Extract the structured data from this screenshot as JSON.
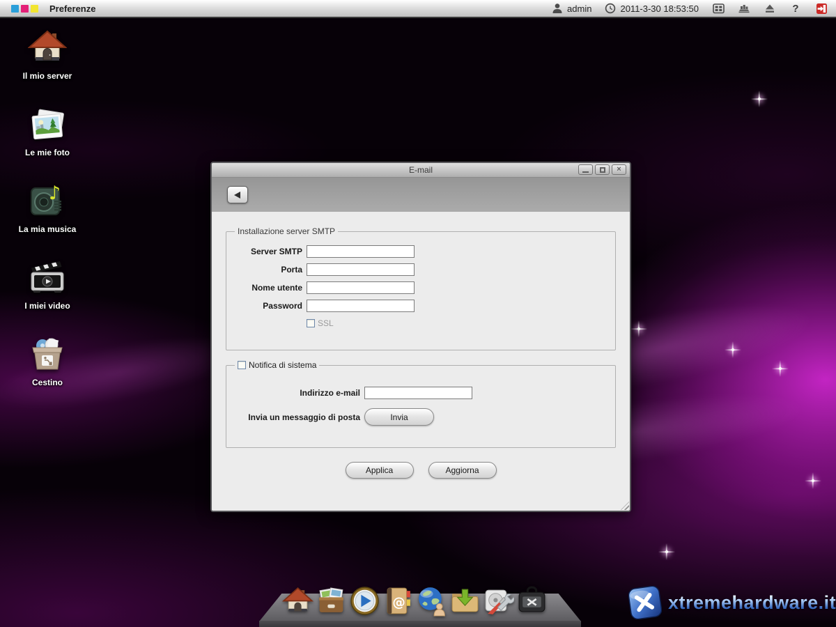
{
  "topbar": {
    "app_title": "Preferenze",
    "logo_colors": [
      "#2b9fd9",
      "#e42178",
      "#f2e531"
    ],
    "user_name": "admin",
    "datetime": "2011-3-30 18:53:50",
    "icons": [
      "user-icon",
      "clock-icon",
      "window-grid-icon",
      "widgets-icon",
      "eject-icon",
      "help-icon",
      "logout-icon"
    ],
    "help_glyph": "?"
  },
  "desktop": {
    "items": [
      {
        "label": "Il mio server",
        "icon": "home-icon"
      },
      {
        "label": "Le mie foto",
        "icon": "photos-icon"
      },
      {
        "label": "La mia musica",
        "icon": "music-icon"
      },
      {
        "label": "I miei video",
        "icon": "videos-icon"
      },
      {
        "label": "Cestino",
        "icon": "trash-icon"
      }
    ]
  },
  "dialog": {
    "title": "E-mail",
    "smtp": {
      "legend": "Installazione server SMTP",
      "fields": [
        {
          "label": "Server SMTP",
          "value": ""
        },
        {
          "label": "Porta",
          "value": ""
        },
        {
          "label": "Nome utente",
          "value": ""
        },
        {
          "label": "Password",
          "value": ""
        }
      ],
      "ssl": {
        "label": "SSL",
        "checked": false
      }
    },
    "notify": {
      "legend": "Notifica di sistema",
      "checked": false,
      "email_label": "Indirizzo e-mail",
      "email_value": "",
      "send_label": "Invia un messaggio di posta",
      "send_button": "Invia"
    },
    "buttons": {
      "apply": "Applica",
      "refresh": "Aggiorna"
    }
  },
  "dock": {
    "icons": [
      "home-dock-icon",
      "photos-dock-icon",
      "media-player-dock-icon",
      "contacts-dock-icon",
      "network-dock-icon",
      "download-dock-icon",
      "disk-utility-dock-icon",
      "toolbox-dock-icon"
    ]
  },
  "watermark": {
    "text": "xtremehardware.it"
  }
}
